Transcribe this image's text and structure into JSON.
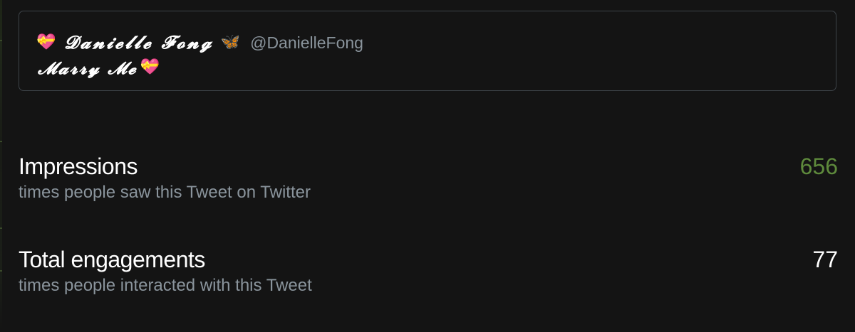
{
  "tweet": {
    "author": {
      "display_name": "𝓓𝓪𝓷𝓲𝓮𝓵𝓵𝓮 𝓕𝓸𝓷𝓰",
      "handle": "@DanielleFong",
      "leading_emoji": "💝",
      "trailing_emoji": "🦋"
    },
    "text": "𝓜𝓪𝓻𝓻𝔂 𝓜𝓮",
    "text_emoji": "💝"
  },
  "stats": {
    "impressions": {
      "label": "Impressions",
      "description": "times people saw this Tweet on Twitter",
      "value": "656",
      "value_color": "#5e8a3c"
    },
    "engagements": {
      "label": "Total engagements",
      "description": "times people interacted with this Tweet",
      "value": "77",
      "value_color": "#ffffff"
    }
  },
  "colors": {
    "background": "#141414",
    "card_border": "#3d4348",
    "secondary_text": "#8a949c",
    "primary_text": "#ffffff"
  },
  "icons": {
    "heart": "heart-with-ribbon-icon",
    "butterfly": "butterfly-icon"
  }
}
